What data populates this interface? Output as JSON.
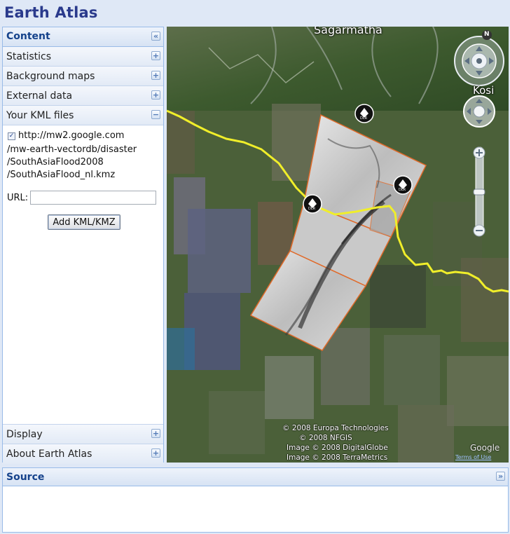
{
  "app": {
    "title": "Earth Atlas"
  },
  "left_panel": {
    "header": "Content",
    "collapse_icon": "double-chevron-left-icon",
    "sections_top": [
      {
        "label": "Statistics",
        "state": "collapsed",
        "icon": "plus-icon"
      },
      {
        "label": "Background maps",
        "state": "collapsed",
        "icon": "plus-icon"
      },
      {
        "label": "External data",
        "state": "collapsed",
        "icon": "plus-icon"
      },
      {
        "label": "Your KML files",
        "state": "expanded",
        "icon": "minus-icon"
      }
    ],
    "kml": {
      "checked": true,
      "file_lines": [
        "http://mw2.google.com",
        "/mw-earth-vectordb/disaster",
        "/SouthAsiaFlood2008",
        "/SouthAsiaFlood_nl.kmz"
      ],
      "url_label": "URL:",
      "url_value": "",
      "add_button": "Add KML/KMZ"
    },
    "sections_bottom": [
      {
        "label": "Display",
        "state": "collapsed",
        "icon": "plus-icon"
      },
      {
        "label": "About Earth Atlas",
        "state": "collapsed",
        "icon": "plus-icon"
      }
    ]
  },
  "map": {
    "place_labels": [
      "Sagarmatha",
      "Kosi"
    ],
    "compass_letter": "N",
    "marker_label": "DLR",
    "credits": [
      "© 2008 Europa Technologies",
      "© 2008 NFGIS",
      "Image © 2008 DigitalGlobe",
      "Image © 2008 TerraMetrics"
    ],
    "logo_text": "Google",
    "terms_text": "Terms of Use",
    "colors": {
      "border_line": "#f0ee2a",
      "footprint_outline": "#e06a2a"
    }
  },
  "source_panel": {
    "header": "Source",
    "icon": "double-chevron-down-icon"
  }
}
